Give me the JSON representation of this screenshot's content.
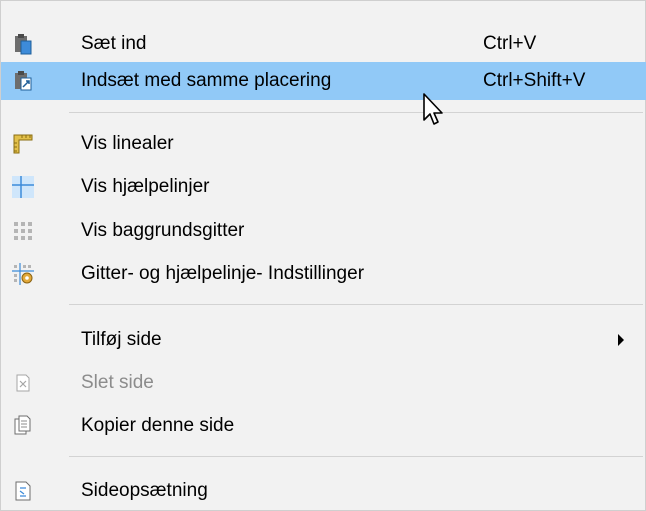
{
  "menu": {
    "paste": {
      "label": "Sæt ind",
      "shortcut": "Ctrl+V",
      "icon": "paste-icon"
    },
    "paste_same_position": {
      "label": "Indsæt med samme placering",
      "shortcut": "Ctrl+Shift+V",
      "icon": "paste-in-place-icon"
    },
    "show_rulers": {
      "label": "Vis linealer",
      "icon": "ruler-icon"
    },
    "show_guides": {
      "label": "Vis hjælpelinjer",
      "icon": "guides-icon"
    },
    "show_grid": {
      "label": "Vis baggrundsgitter",
      "icon": "grid-icon"
    },
    "grid_settings": {
      "label": "Gitter- og hjælpelinje- Indstillinger",
      "icon": "grid-settings-icon"
    },
    "add_page": {
      "label": "Tilføj side",
      "icon": "submenu-arrow-icon"
    },
    "delete_page": {
      "label": "Slet side",
      "icon": "delete-page-icon",
      "disabled": true
    },
    "copy_page": {
      "label": "Kopier denne side",
      "icon": "copy-page-icon"
    },
    "page_setup": {
      "label": "Sideopsætning",
      "icon": "page-setup-icon"
    }
  },
  "colors": {
    "menu_background": "#f2f2f2",
    "hover_background": "#91c9f7",
    "separator": "#d3d3d3",
    "disabled_text": "#8c8c8c"
  }
}
